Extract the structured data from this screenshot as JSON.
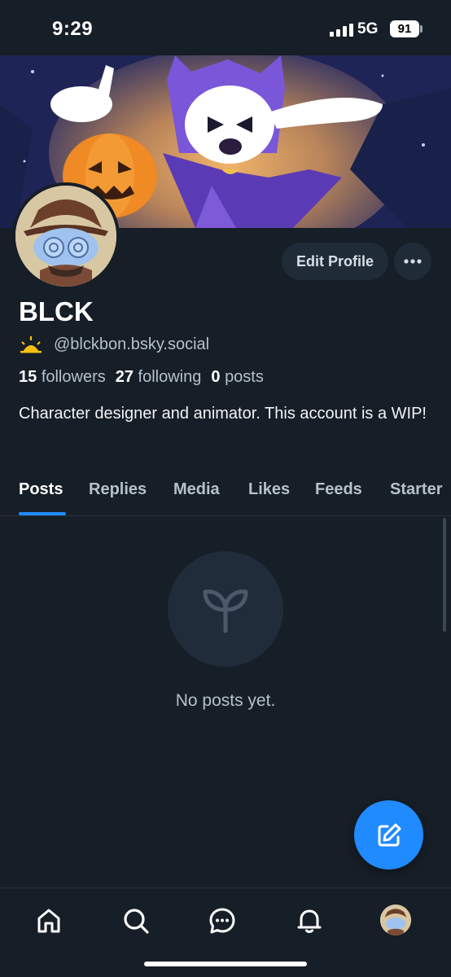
{
  "status_bar": {
    "time": "9:29",
    "network": "5G",
    "battery": "91"
  },
  "profile": {
    "display_name": "BLCK",
    "handle": "@blckbon.bsky.social",
    "handle_icon": "sunrise-icon",
    "followers_count": "15",
    "followers_label": "followers",
    "following_count": "27",
    "following_label": "following",
    "posts_count": "0",
    "posts_label": "posts",
    "bio": "Character designer and animator. This account is a WIP!",
    "edit_button": "Edit Profile",
    "more_icon": "more-horizontal-icon"
  },
  "tabs": [
    {
      "label": "Posts",
      "active": true
    },
    {
      "label": "Replies",
      "active": false
    },
    {
      "label": "Media",
      "active": false
    },
    {
      "label": "Likes",
      "active": false
    },
    {
      "label": "Feeds",
      "active": false
    },
    {
      "label": "Starter",
      "active": false
    }
  ],
  "empty_state": {
    "icon": "sprout-icon",
    "message": "No posts yet."
  },
  "fab": {
    "icon": "compose-icon"
  },
  "bottom_nav": [
    {
      "name": "home",
      "icon": "home-icon"
    },
    {
      "name": "search",
      "icon": "search-icon"
    },
    {
      "name": "chat",
      "icon": "chat-icon"
    },
    {
      "name": "notifications",
      "icon": "bell-icon"
    },
    {
      "name": "profile",
      "icon": "avatar"
    }
  ],
  "colors": {
    "background": "#161e27",
    "accent": "#208bfe",
    "secondary_text": "#b6c1cc",
    "button_bg": "#1f2b37"
  }
}
